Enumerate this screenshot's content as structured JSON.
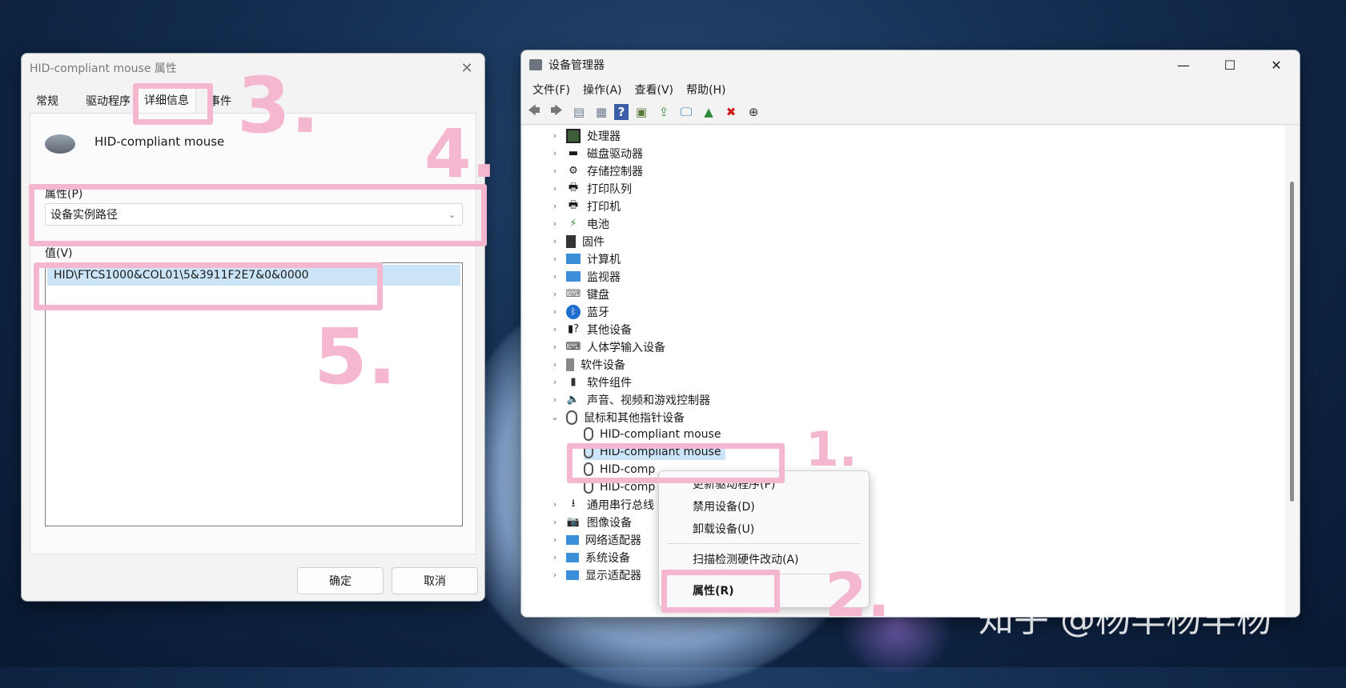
{
  "colors": {
    "highlight": "#f5b7cf",
    "selection": "#cce4f7",
    "window_bg": "#f3f3f3"
  },
  "dialog": {
    "title": "HID-compliant mouse 属性",
    "close_icon": "close-icon",
    "tabs": [
      "常规",
      "驱动程序",
      "详细信息",
      "事件"
    ],
    "active_tab": "详细信息",
    "device_name": "HID-compliant mouse",
    "property_label": "属性(P)",
    "property_value": "设备实例路径",
    "value_label": "值(V)",
    "value_text": "HID\\FTCS1000&COL01\\5&3911F2E7&0&0000",
    "ok": "确定",
    "cancel": "取消"
  },
  "devmgr": {
    "title": "设备管理器",
    "menu": [
      "文件(F)",
      "操作(A)",
      "查看(V)",
      "帮助(H)"
    ],
    "tree": [
      {
        "label": "处理器",
        "icon": "processor-icon",
        "expanded": false
      },
      {
        "label": "磁盘驱动器",
        "icon": "disk-icon",
        "expanded": false
      },
      {
        "label": "存储控制器",
        "icon": "storage-controller-icon",
        "expanded": false
      },
      {
        "label": "打印队列",
        "icon": "print-queue-icon",
        "expanded": false
      },
      {
        "label": "打印机",
        "icon": "printer-icon",
        "expanded": false
      },
      {
        "label": "电池",
        "icon": "battery-icon",
        "expanded": false
      },
      {
        "label": "固件",
        "icon": "firmware-icon",
        "expanded": false
      },
      {
        "label": "计算机",
        "icon": "computer-icon",
        "expanded": false
      },
      {
        "label": "监视器",
        "icon": "monitor-icon",
        "expanded": false
      },
      {
        "label": "键盘",
        "icon": "keyboard-icon",
        "expanded": false
      },
      {
        "label": "蓝牙",
        "icon": "bluetooth-icon",
        "expanded": false
      },
      {
        "label": "其他设备",
        "icon": "unknown-device-icon",
        "expanded": false
      },
      {
        "label": "人体学输入设备",
        "icon": "hid-icon",
        "expanded": false
      },
      {
        "label": "软件设备",
        "icon": "software-device-icon",
        "expanded": false
      },
      {
        "label": "软件组件",
        "icon": "software-component-icon",
        "expanded": false
      },
      {
        "label": "声音、视频和游戏控制器",
        "icon": "speaker-icon",
        "expanded": false
      },
      {
        "label": "鼠标和其他指针设备",
        "icon": "mouse-icon",
        "expanded": true
      }
    ],
    "mice": [
      "HID-compliant mouse",
      "HID-compliant mouse",
      "HID-comp",
      "HID-comp"
    ],
    "tree_after": [
      {
        "label": "通用串行总线",
        "icon": "usb-icon"
      },
      {
        "label": "图像设备",
        "icon": "camera-icon"
      },
      {
        "label": "网络适配器",
        "icon": "network-icon"
      },
      {
        "label": "系统设备",
        "icon": "system-device-icon"
      },
      {
        "label": "显示适配器",
        "icon": "display-adapter-icon"
      }
    ],
    "context_menu": [
      "更新驱动程序(P)",
      "禁用设备(D)",
      "卸载设备(U)",
      "扫描检测硬件改动(A)",
      "属性(R)"
    ]
  },
  "annotations": [
    "3.",
    "4.",
    "5.",
    "1.",
    "2."
  ],
  "watermark": "知乎 @杨羊杨羊杨"
}
